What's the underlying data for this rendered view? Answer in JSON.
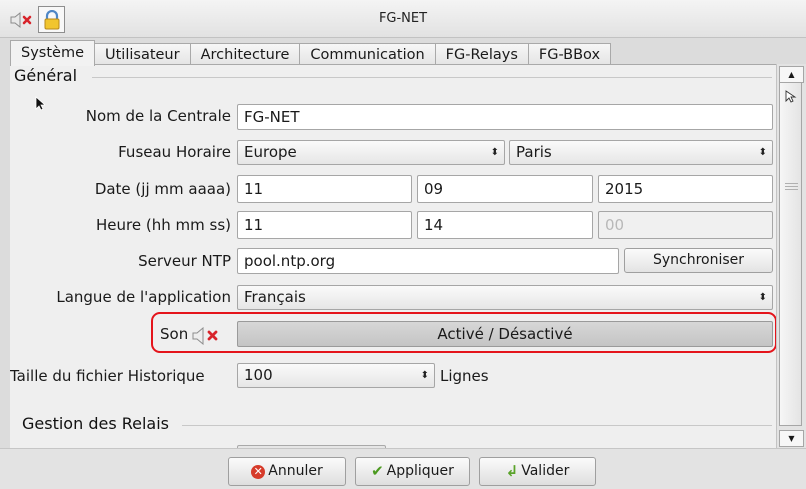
{
  "window": {
    "title": "FG-NET",
    "mute_icon": "speaker-muted-icon",
    "lock_icon": "padlock-icon"
  },
  "tabs": [
    {
      "label": "Système",
      "active": true
    },
    {
      "label": "Utilisateur"
    },
    {
      "label": "Architecture"
    },
    {
      "label": "Communication"
    },
    {
      "label": "FG-Relays"
    },
    {
      "label": "FG-BBox"
    }
  ],
  "general": {
    "title": "Général",
    "nom_centrale": {
      "label": "Nom de la Centrale",
      "value": "FG-NET"
    },
    "fuseau": {
      "label": "Fuseau Horaire",
      "region": "Europe",
      "city": "Paris"
    },
    "date": {
      "label": "Date (jj mm aaaa)",
      "day": "11",
      "month": "09",
      "year": "2015"
    },
    "heure": {
      "label": "Heure (hh mm ss)",
      "hours": "11",
      "minutes": "14",
      "seconds": "00"
    },
    "ntp": {
      "label": "Serveur NTP",
      "value": "pool.ntp.org",
      "sync_button": "Synchroniser"
    },
    "langue": {
      "label": "Langue de l'application",
      "value": "Français"
    },
    "son": {
      "label": "Son",
      "toggle_label": "Activé / Désactivé",
      "icon": "speaker-muted-icon"
    },
    "historique": {
      "label": "Taille du fichier Historique",
      "value": "100",
      "unit": "Lignes"
    }
  },
  "relais": {
    "title": "Gestion des Relais"
  },
  "footer": {
    "cancel": "Annuler",
    "apply": "Appliquer",
    "validate": "Valider"
  },
  "colors": {
    "highlight": "#e4141b",
    "cancel_icon": "#d63b2a",
    "check_icon": "#4c9a20"
  }
}
